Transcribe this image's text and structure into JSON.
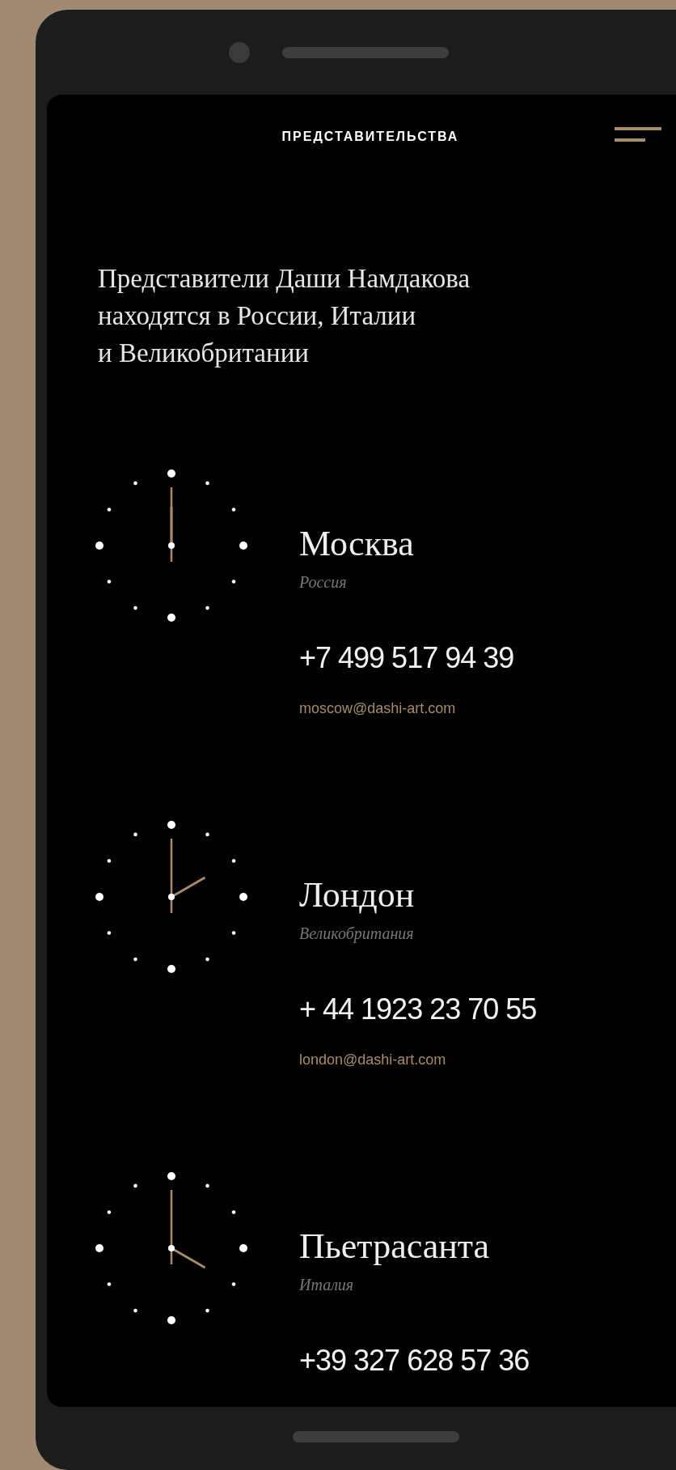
{
  "header": {
    "title": "ПРЕДСТАВИТЕЛЬСТВА"
  },
  "intro": "Представители Даши Намдакова находятся в России, Италии и Великобритании",
  "offices": [
    {
      "city": "Москва",
      "country": "Россия",
      "phone": "+7 499 517 94 39",
      "email": "moscow@dashi-art.com",
      "clock": {
        "kind": "twelve"
      }
    },
    {
      "city": "Лондон",
      "country": "Великобритания",
      "phone": "+ 44 1923 23 70 55",
      "email": "london@dashi-art.com",
      "clock": {
        "kind": "two"
      }
    },
    {
      "city": "Пьетрасанта",
      "country": "Италия",
      "phone": "+39 327 628 57 36",
      "clock": {
        "kind": "four"
      }
    }
  ]
}
